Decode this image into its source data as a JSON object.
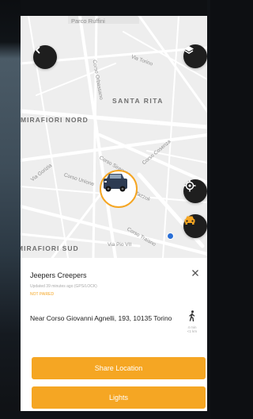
{
  "map": {
    "district_labels": [
      "SANTA RITA",
      "MIRAFIORI NORD",
      "MIRAFIORI SUD"
    ],
    "street_labels": [
      "Parco Ruffini",
      "Via Torino",
      "Corso Orbassano",
      "Corso Siracusa",
      "Corso Cosenza",
      "Via Gorizia",
      "Corso Unione",
      "Corso Tazzoli",
      "Corso Traiano",
      "Via Pio VII"
    ],
    "user_location_color": "#2a6fd6"
  },
  "controls": {
    "back_icon": "chevron-left-icon",
    "layers_icon": "layers-icon",
    "locate_icon": "crosshair-icon",
    "car_icon": "car-icon"
  },
  "vehicle": {
    "name": "Jeepers Creepers",
    "subtitle": "Updated 39 minutes ago (GPS/LOCK)",
    "status": "NOT PAIRED",
    "address": "Near Corso Giovanni Agnelli, 193, 10135 Torino",
    "walk_time": "4 min",
    "walk_distance": "<1 km"
  },
  "actions": {
    "share_label": "Share Location",
    "lights_label": "Lights"
  },
  "colors": {
    "accent": "#f5a623",
    "dark_button": "#1e1e1e"
  }
}
